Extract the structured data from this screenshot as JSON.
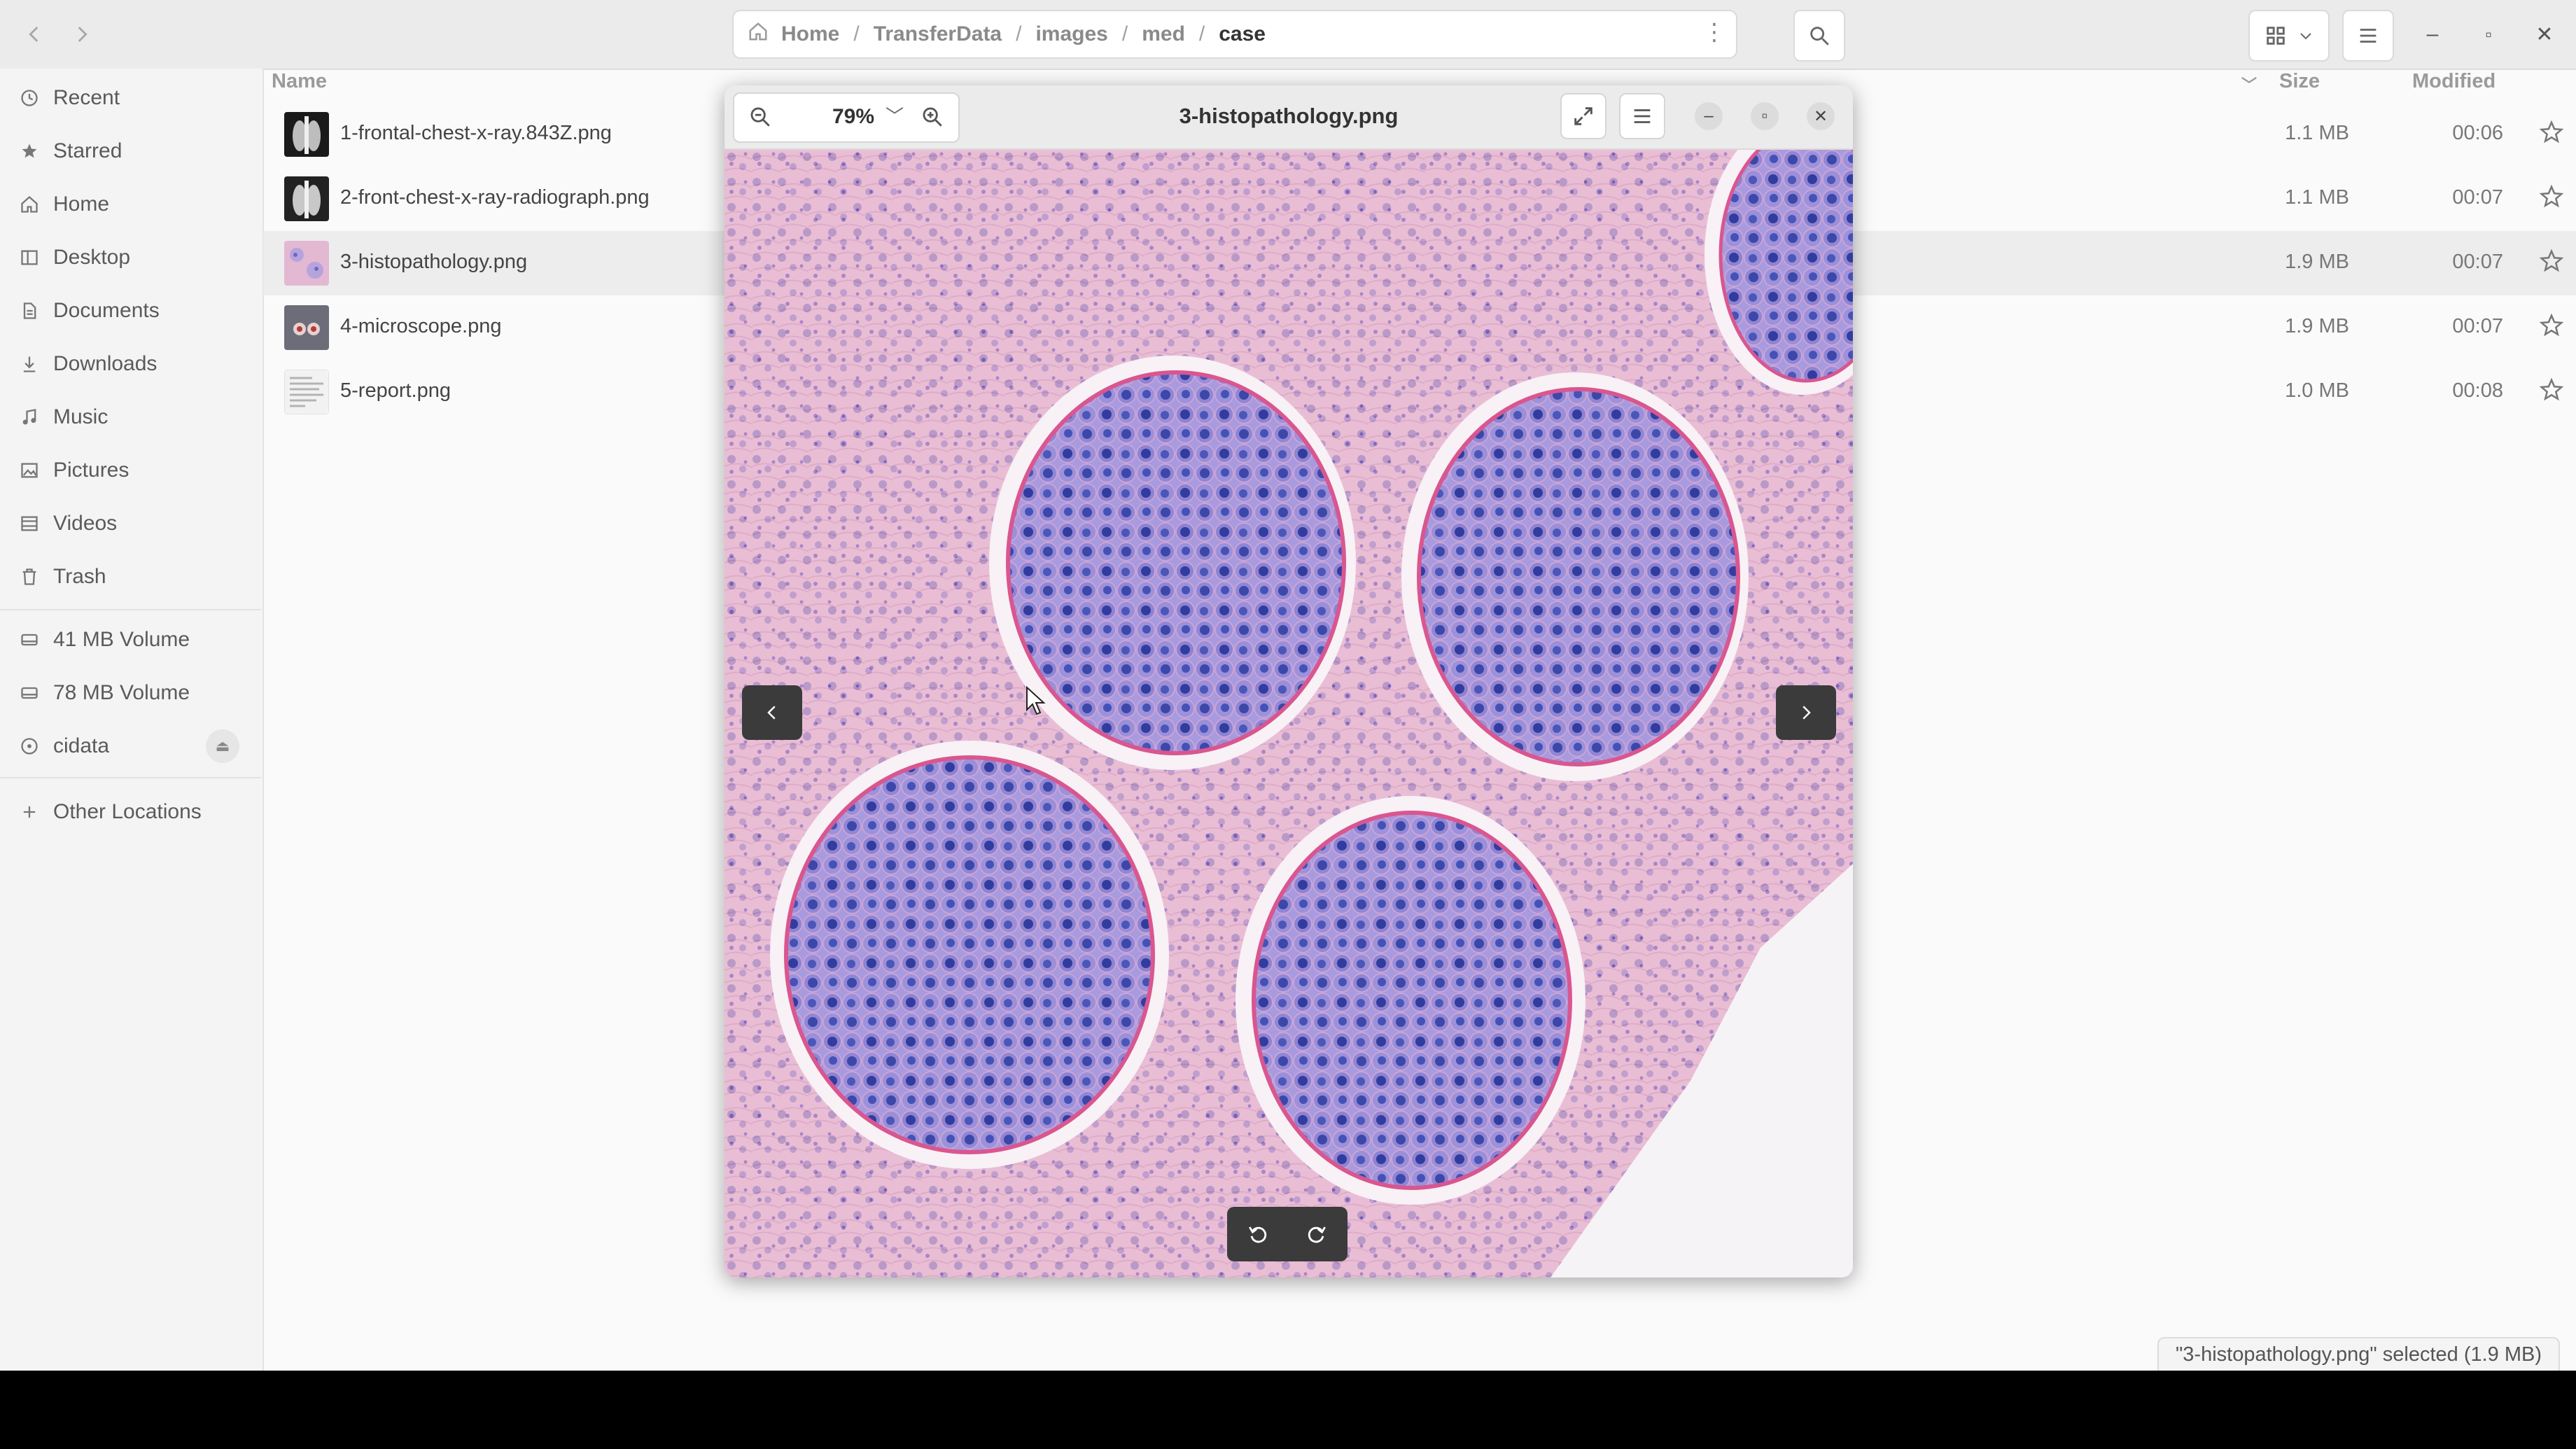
{
  "header": {
    "breadcrumb": [
      "Home",
      "TransferData",
      "images",
      "med",
      "case"
    ]
  },
  "sidebar": {
    "places": [
      {
        "label": "Recent",
        "icon": "clock-icon"
      },
      {
        "label": "Starred",
        "icon": "star-icon"
      },
      {
        "label": "Home",
        "icon": "home-icon"
      },
      {
        "label": "Desktop",
        "icon": "desktop-icon"
      },
      {
        "label": "Documents",
        "icon": "document-icon"
      },
      {
        "label": "Downloads",
        "icon": "download-icon"
      },
      {
        "label": "Music",
        "icon": "music-icon"
      },
      {
        "label": "Pictures",
        "icon": "picture-icon"
      },
      {
        "label": "Videos",
        "icon": "video-icon"
      },
      {
        "label": "Trash",
        "icon": "trash-icon"
      }
    ],
    "volumes": [
      {
        "label": "41 MB Volume",
        "icon": "drive-icon"
      },
      {
        "label": "78 MB Volume",
        "icon": "drive-icon"
      },
      {
        "label": "cidata",
        "icon": "disc-icon"
      }
    ],
    "other_locations": "Other Locations"
  },
  "columns": {
    "name": "Name",
    "size": "Size",
    "modified": "Modified"
  },
  "files": [
    {
      "name": "1-frontal-chest-x-ray.843Z.png",
      "size": "1.1 MB",
      "modified": "00:06"
    },
    {
      "name": "2-front-chest-x-ray-radiograph.png",
      "size": "1.1 MB",
      "modified": "00:07"
    },
    {
      "name": "3-histopathology.png",
      "size": "1.9 MB",
      "modified": "00:07"
    },
    {
      "name": "4-microscope.png",
      "size": "1.9 MB",
      "modified": "00:07"
    },
    {
      "name": "5-report.png",
      "size": "1.0 MB",
      "modified": "00:08"
    }
  ],
  "selected_index": 2,
  "status_text": "\"3-histopathology.png\" selected  (1.9 MB)",
  "viewer": {
    "title": "3-histopathology.png",
    "zoom": "79%"
  },
  "colors": {
    "stain_pink": "#e7b3cd",
    "nucleus_blue": "#4a4fb5",
    "cell_lilac": "#9a8fd6"
  }
}
